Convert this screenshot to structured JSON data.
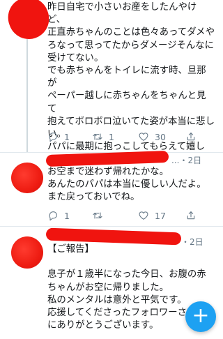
{
  "tweets": [
    {
      "text": "昨日自宅で小さいお産をしたんやけど、\n正直赤ちゃんのことは色々あってダメや\nろなって思ってたからダメージそんなに\n受けてない。\nでも赤ちゃんをトイレに流す時、旦那が\nペーパー越しに赤ちゃんをちゃんと見て\n抱えてボロボロ泣いてた姿が本当に悲し\nい。\nパパに最期に抱っこしてもらえて嬉し\nかったかな。",
      "reply_count": "1",
      "retweet_count": "1",
      "like_count": "30"
    },
    {
      "meta_suffix": "...・2日",
      "text": "お空まで迷わず帰れたかな。\nあんたのパパは本当に優しい人だよ。\nまた戻っておいでね。",
      "reply_count": "1",
      "retweet_count": "",
      "like_count": "17"
    },
    {
      "meta_suffix": "・2日",
      "text": "【ご報告】\n\n息子が１歳半になった今日、お腹の赤\nちゃんがお空に帰りました。\n私のメンタルは意外と平気です。\n応援してくださったフォロワーさ\nにありがとうございます。"
    }
  ],
  "fab": {
    "icon": "plus-icon",
    "glyph": "+"
  },
  "colors": {
    "accent": "#1da1f2",
    "redaction": "#f0140f",
    "meta": "#657786"
  }
}
